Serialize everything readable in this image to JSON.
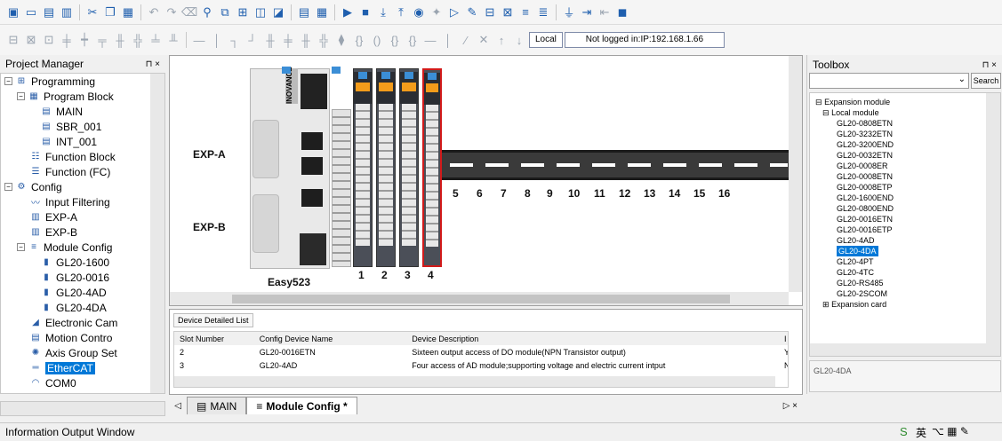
{
  "toolbar": {
    "local_label": "Local",
    "login_status": "Not logged in:IP:192.168.1.66"
  },
  "project_manager": {
    "title": "Project Manager",
    "pin": "⊓ ×",
    "items": [
      "Programming",
      "Program Block",
      "MAIN",
      "SBR_001",
      "INT_001",
      "Function Block",
      "Function (FC)",
      "Config",
      "Input Filtering",
      "EXP-A",
      "EXP-B",
      "Module Config",
      "GL20-1600",
      "GL20-0016",
      "GL20-4AD",
      "GL20-4DA",
      "Electronic Cam",
      "Motion Contro",
      "Axis Group Set",
      "EtherCAT",
      "COM0"
    ]
  },
  "canvas": {
    "exp_a": "EXP-A",
    "exp_b": "EXP-B",
    "brand": "Easy523",
    "vendor": "INOVANCE",
    "slot_labels": [
      "1",
      "2",
      "3",
      "4"
    ],
    "rail_numbers": [
      "5",
      "6",
      "7",
      "8",
      "9",
      "10",
      "11",
      "12",
      "13",
      "14",
      "15",
      "16"
    ]
  },
  "device_list": {
    "title": "Device Detailed List",
    "headers": [
      "Slot Number",
      "Config Device Name",
      "Device Description",
      "I"
    ],
    "rows": [
      {
        "slot": "2",
        "name": "GL20-0016ETN",
        "desc": "Sixteen output access of DO module(NPN Transistor output)",
        "extra": "Y"
      },
      {
        "slot": "3",
        "name": "GL20-4AD",
        "desc": "Four access of AD module;supporting voltage and electric current intput",
        "extra": "N"
      }
    ]
  },
  "tabs": [
    {
      "label": "MAIN"
    },
    {
      "label": "Module Config *"
    }
  ],
  "toolbox": {
    "title": "Toolbox",
    "pin": "⊓ ×",
    "search_label": "Search",
    "root": "Expansion module",
    "local": "Local module",
    "items": [
      "GL20-0808ETN",
      "GL20-3232ETN",
      "GL20-3200END",
      "GL20-0032ETN",
      "GL20-0008ER",
      "GL20-0008ETN",
      "GL20-0008ETP",
      "GL20-1600END",
      "GL20-0800END",
      "GL20-0016ETN",
      "GL20-0016ETP",
      "GL20-4AD",
      "GL20-4DA",
      "GL20-4PT",
      "GL20-4TC",
      "GL20-RS485",
      "GL20-2SCOM"
    ],
    "expansion_card": "Expansion card",
    "selected": "GL20-4DA",
    "detail": "GL20-4DA"
  },
  "status_bar": {
    "text": "Information Output Window",
    "ime": "英"
  },
  "colors": {
    "select": "#0078d7",
    "highlight_border": "#d21a1a",
    "module_orange": "#f39c1b"
  }
}
